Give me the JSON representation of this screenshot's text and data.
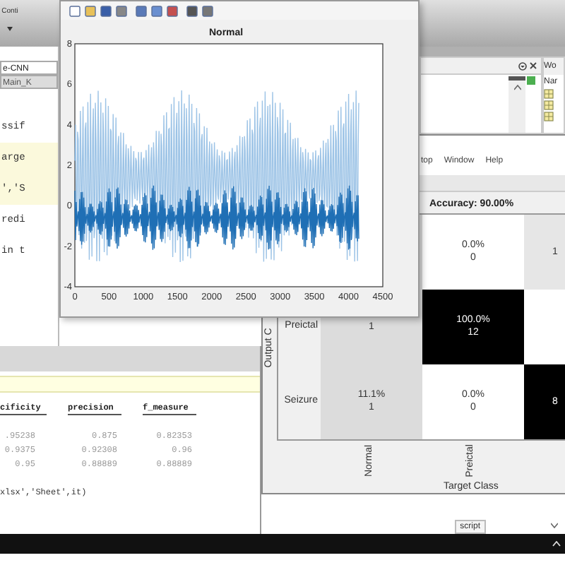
{
  "main_toolbar": {
    "label": "Conti"
  },
  "editor": {
    "tabs": [
      {
        "label": "e-CNN",
        "selected": true
      },
      {
        "label": "Main_K",
        "selected": false
      }
    ],
    "code_lines": [
      {
        "text": "ssif",
        "highlighted": false
      },
      {
        "text": "arge",
        "highlighted": true
      },
      {
        "text": "','S",
        "highlighted": true
      },
      {
        "text": "redi",
        "highlighted": false
      },
      {
        "text": "in t",
        "highlighted": false
      }
    ]
  },
  "workspace": {
    "title": "Wo",
    "column": "Nar"
  },
  "command_window": {
    "table": {
      "columns": [
        "cificity",
        "precision",
        "f_measure"
      ],
      "rows": [
        [
          ".95238",
          "0.875",
          "0.82353"
        ],
        [
          "0.9375",
          "0.92308",
          "0.96"
        ],
        [
          "0.95",
          "0.88889",
          "0.88889"
        ]
      ]
    },
    "code_line": "xlsx','Sheet',it)"
  },
  "script_tab": "script",
  "confusion_figure": {
    "menu": [
      "top",
      "Window",
      "Help"
    ],
    "title": "Accuracy: 90.00%",
    "ylabel": "Output C",
    "xlabel": "Target Class",
    "rows": [
      {
        "cells": [
          {
            "kind": "gray"
          },
          {
            "percent": "0.0%",
            "count": "0",
            "kind": "white"
          },
          {
            "percent": "1",
            "kind": "light"
          }
        ]
      },
      {
        "label": "Preictal",
        "cells": [
          {
            "count": "1",
            "kind": "gray"
          },
          {
            "percent": "100.0%",
            "count": "12",
            "kind": "black"
          },
          {
            "kind": "white"
          }
        ]
      },
      {
        "label": "Seizure",
        "cells": [
          {
            "percent": "11.1%",
            "count": "1",
            "kind": "gray"
          },
          {
            "percent": "0.0%",
            "count": "0",
            "kind": "white"
          },
          {
            "percent": "8",
            "kind": "black"
          }
        ]
      }
    ],
    "column_labels": [
      "Normal",
      "Preictal"
    ]
  },
  "plot_figure": {
    "title": "Normal",
    "xticks": [
      "0",
      "500",
      "1000",
      "1500",
      "2000",
      "2500",
      "3000",
      "3500",
      "4000",
      "4500"
    ],
    "yticks": [
      "8",
      "6",
      "4",
      "2",
      "0",
      "-2",
      "-4"
    ]
  }
}
